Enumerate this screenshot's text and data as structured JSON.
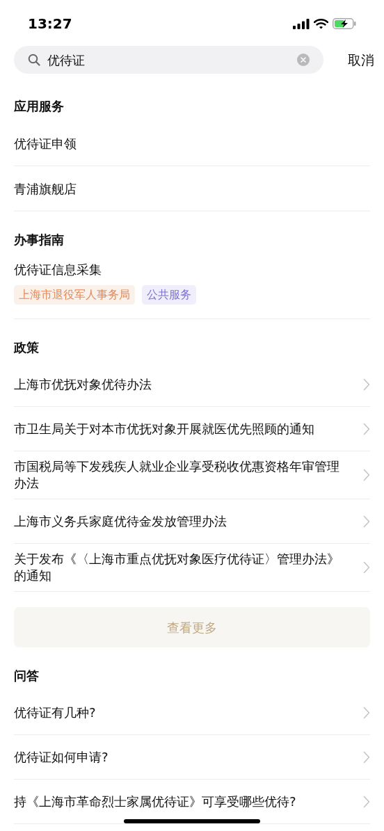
{
  "status_bar": {
    "time": "13:27"
  },
  "search": {
    "value": "优待证",
    "cancel": "取消"
  },
  "sections": [
    {
      "kind": "list",
      "title": "应用服务",
      "items": [
        {
          "title": "优待证申领"
        },
        {
          "title": "青浦旗舰店"
        }
      ]
    },
    {
      "kind": "guide",
      "title": "办事指南",
      "items": [
        {
          "title": "优待证信息采集",
          "tags": [
            {
              "label": "上海市退役军人事务局",
              "color": "#e08a5c"
            },
            {
              "label": "公共服务",
              "color": "#7b72d6"
            }
          ]
        }
      ]
    },
    {
      "kind": "links",
      "title": "政策",
      "items": [
        {
          "title": "上海市优抚对象优待办法"
        },
        {
          "title": "市卫生局关于对本市优抚对象开展就医优先照顾的通知"
        },
        {
          "title": "市国税局等下发残疾人就业企业享受税收优惠资格年审管理办法"
        },
        {
          "title": "上海市义务兵家庭优待金发放管理办法"
        },
        {
          "title": "关于发布《〈上海市重点优抚对象医疗优待证〉管理办法》的通知"
        }
      ],
      "more": "查看更多"
    },
    {
      "kind": "links",
      "title": "问答",
      "items": [
        {
          "title": "优待证有几种?"
        },
        {
          "title": "优待证如何申请?"
        },
        {
          "title": "持《上海市革命烈士家属优待证》可享受哪些优待?"
        }
      ]
    }
  ]
}
